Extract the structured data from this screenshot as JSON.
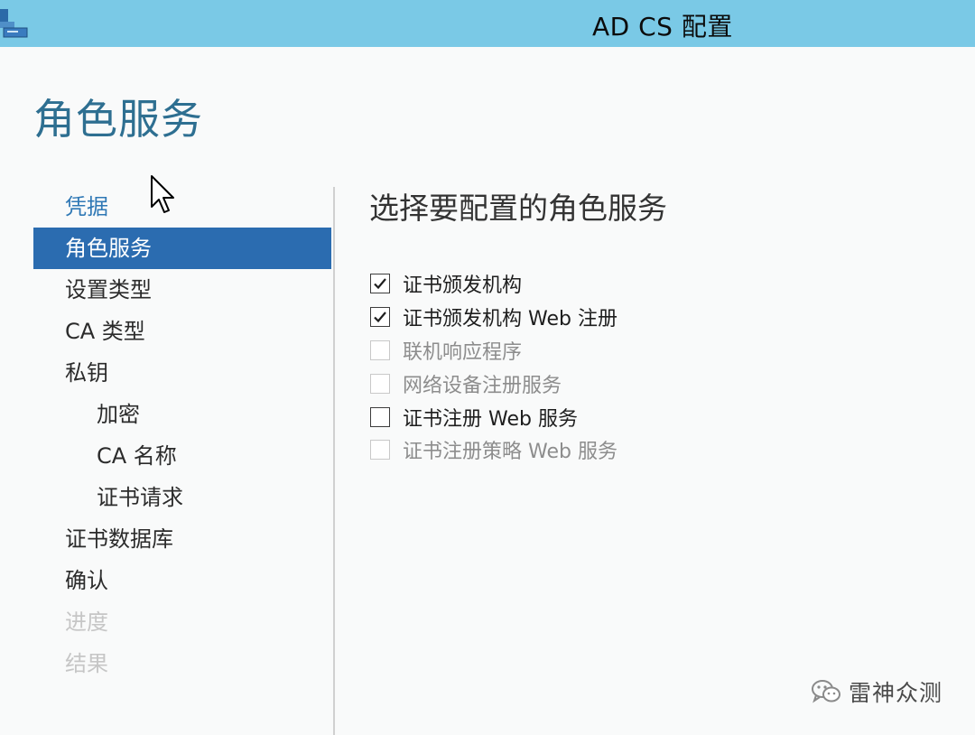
{
  "window": {
    "title": "AD CS 配置",
    "app_icon": "server-manager-icon"
  },
  "page": {
    "title": "角色服务"
  },
  "nav": {
    "items": [
      {
        "label": "凭据",
        "state": "link"
      },
      {
        "label": "角色服务",
        "state": "active"
      },
      {
        "label": "设置类型",
        "state": "normal"
      },
      {
        "label": "CA 类型",
        "state": "normal"
      },
      {
        "label": "私钥",
        "state": "normal"
      },
      {
        "label": "加密",
        "state": "normal",
        "indent": true
      },
      {
        "label": "CA 名称",
        "state": "normal",
        "indent": true
      },
      {
        "label": "证书请求",
        "state": "normal",
        "indent": true
      },
      {
        "label": "证书数据库",
        "state": "normal"
      },
      {
        "label": "确认",
        "state": "normal"
      },
      {
        "label": "进度",
        "state": "disabled"
      },
      {
        "label": "结果",
        "state": "disabled"
      }
    ]
  },
  "main": {
    "heading": "选择要配置的角色服务",
    "options": [
      {
        "label": "证书颁发机构",
        "checked": true,
        "enabled": true
      },
      {
        "label": "证书颁发机构 Web 注册",
        "checked": true,
        "enabled": true
      },
      {
        "label": "联机响应程序",
        "checked": false,
        "enabled": false
      },
      {
        "label": "网络设备注册服务",
        "checked": false,
        "enabled": false
      },
      {
        "label": "证书注册 Web 服务",
        "checked": false,
        "enabled": true
      },
      {
        "label": "证书注册策略 Web 服务",
        "checked": false,
        "enabled": false
      }
    ]
  },
  "watermark": {
    "text": "雷神众测",
    "icon": "wechat-icon"
  },
  "colors": {
    "titlebar": "#7ac9e6",
    "page_title": "#2e6f91",
    "nav_active_bg": "#2b6cb0",
    "nav_link": "#2f78b5",
    "disabled_text": "#c6c6c6"
  }
}
